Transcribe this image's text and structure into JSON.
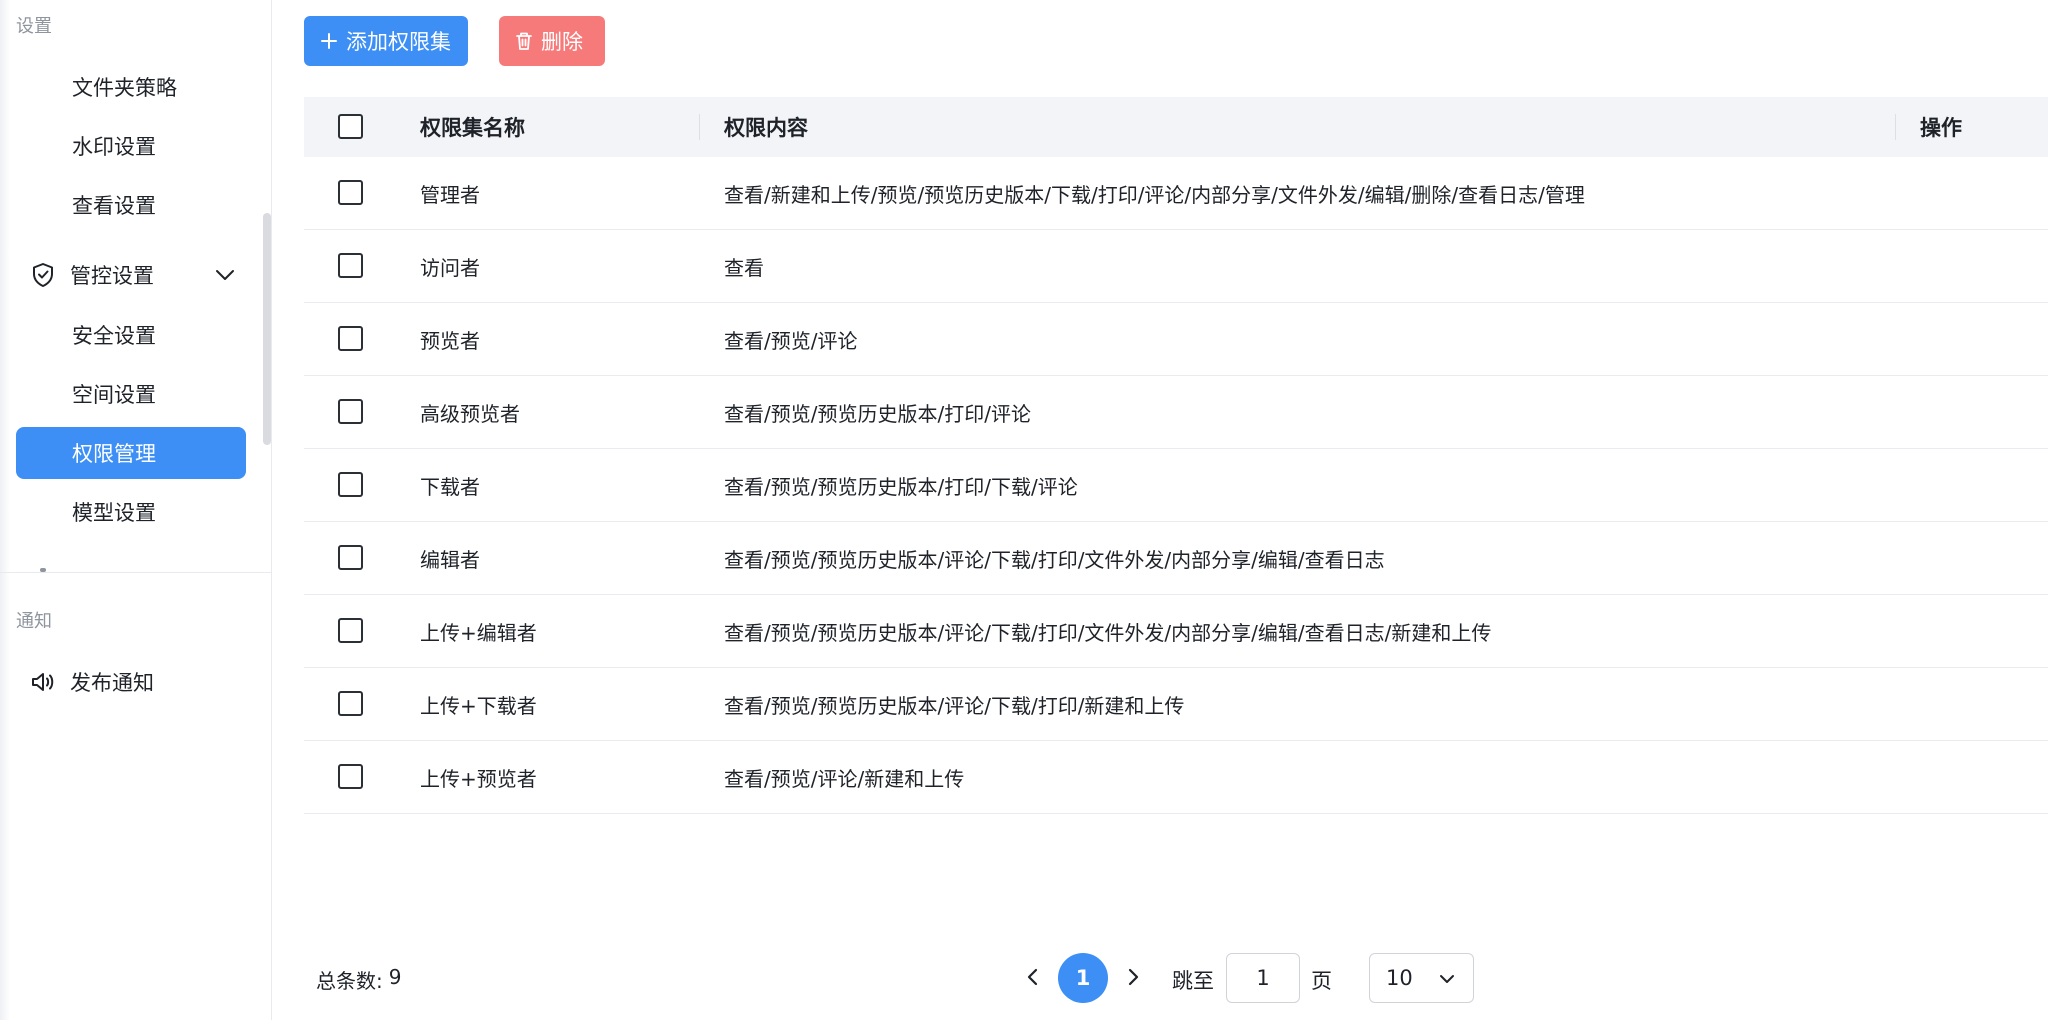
{
  "sidebar": {
    "settings_label": "设置",
    "items_top": [
      {
        "label": "文件夹策略"
      },
      {
        "label": "水印设置"
      },
      {
        "label": "查看设置"
      }
    ],
    "group": {
      "label": "管控设置",
      "icon": "shield-check-icon"
    },
    "group_items": [
      {
        "label": "安全设置"
      },
      {
        "label": "空间设置"
      },
      {
        "label": "权限管理",
        "active": true
      },
      {
        "label": "模型设置"
      }
    ],
    "notify_label": "通知",
    "notify_item": {
      "label": "发布通知",
      "icon": "speaker-icon"
    }
  },
  "toolbar": {
    "add_label": "添加权限集",
    "delete_label": "删除"
  },
  "table": {
    "headers": {
      "name": "权限集名称",
      "perm": "权限内容",
      "op": "操作"
    },
    "rows": [
      {
        "name": "管理者",
        "perm": "查看/新建和上传/预览/预览历史版本/下载/打印/评论/内部分享/文件外发/编辑/删除/查看日志/管理"
      },
      {
        "name": "访问者",
        "perm": "查看"
      },
      {
        "name": "预览者",
        "perm": "查看/预览/评论"
      },
      {
        "name": "高级预览者",
        "perm": "查看/预览/预览历史版本/打印/评论"
      },
      {
        "name": "下载者",
        "perm": "查看/预览/预览历史版本/打印/下载/评论"
      },
      {
        "name": "编辑者",
        "perm": "查看/预览/预览历史版本/评论/下载/打印/文件外发/内部分享/编辑/查看日志"
      },
      {
        "name": "上传+编辑者",
        "perm": "查看/预览/预览历史版本/评论/下载/打印/文件外发/内部分享/编辑/查看日志/新建和上传"
      },
      {
        "name": "上传+下载者",
        "perm": "查看/预览/预览历史版本/评论/下载/打印/新建和上传"
      },
      {
        "name": "上传+预览者",
        "perm": "查看/预览/评论/新建和上传"
      }
    ]
  },
  "footer": {
    "total_label": "总条数:",
    "total_value": "9",
    "current_page": "1",
    "jump_label": "跳至",
    "jump_value": "1",
    "page_unit": "页",
    "page_size": "10"
  },
  "colors": {
    "accent": "#3d8ff5",
    "danger": "#f77a7a",
    "header_bg": "#f2f4f7"
  }
}
